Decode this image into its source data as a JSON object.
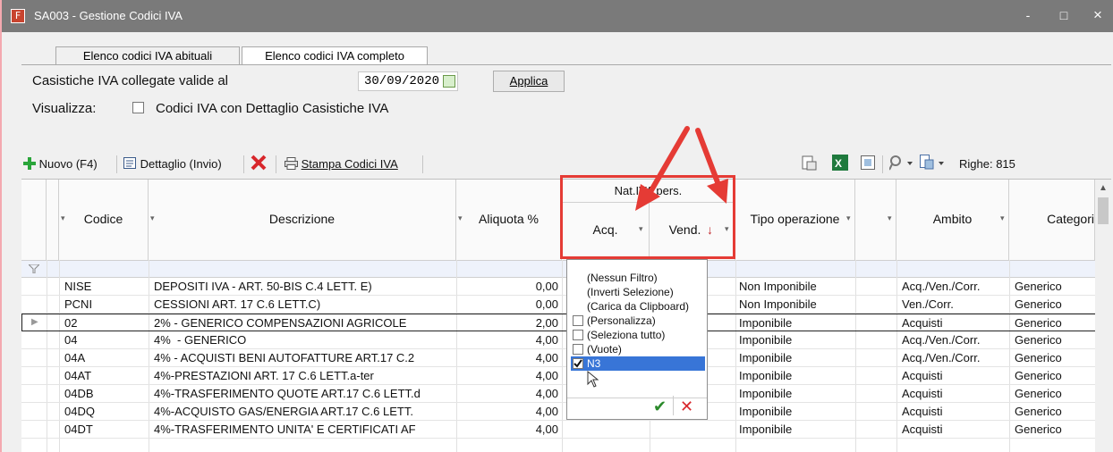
{
  "window": {
    "title": "SA003 - Gestione Codici IVA",
    "app_icon": "F",
    "minimize_label": "-",
    "maximize_label": "□",
    "close_label": "×"
  },
  "tabs": [
    {
      "label": "Elenco codici IVA abituali",
      "active": false
    },
    {
      "label": "Elenco codici IVA completo",
      "active": true
    }
  ],
  "filters": {
    "casistiche_label": "Casistiche IVA collegate valide al",
    "date_value": "30/09/2020",
    "apply_label": "Applica",
    "visualizza_label": "Visualizza:",
    "dettaglio_label": "Codici IVA con Dettaglio Casistiche IVA"
  },
  "toolbar": {
    "new_label": "Nuovo (F4)",
    "detail_label": "Dettaglio (Invio)",
    "print_label": "Stampa Codici IVA",
    "rows_label": "Righe: 815"
  },
  "grid": {
    "group_header": "Nat.IVA pers.",
    "headers": {
      "codice": "Codice",
      "descrizione": "Descrizione",
      "aliquota": "Aliquota %",
      "acq": "Acq.",
      "vend": "Vend.",
      "tipo": "Tipo operazione",
      "ambito": "Ambito",
      "categoria": "Categori"
    },
    "rows": [
      {
        "codice": "NISE",
        "descrizione": "DEPOSITI IVA - ART. 50-BIS C.4 LETT. E)",
        "aliquota": "0,00",
        "tipo": "Non Imponibile",
        "ambito": "Acq./Ven./Corr.",
        "categoria": "Generico"
      },
      {
        "codice": "PCNI",
        "descrizione": "CESSIONI ART. 17 C.6 LETT.C)",
        "aliquota": "0,00",
        "tipo": "Non Imponibile",
        "ambito": "Ven./Corr.",
        "categoria": "Generico"
      },
      {
        "codice": "02",
        "descrizione": "2% - GENERICO COMPENSAZIONI AGRICOLE",
        "aliquota": "2,00",
        "tipo": "Imponibile",
        "ambito": "Acquisti",
        "categoria": "Generico"
      },
      {
        "codice": "04",
        "descrizione": "4%  - GENERICO",
        "aliquota": "4,00",
        "tipo": "Imponibile",
        "ambito": "Acq./Ven./Corr.",
        "categoria": "Generico"
      },
      {
        "codice": "04A",
        "descrizione": "4% - ACQUISTI BENI AUTOFATTURE ART.17 C.2",
        "aliquota": "4,00",
        "tipo": "Imponibile",
        "ambito": "Acq./Ven./Corr.",
        "categoria": "Generico"
      },
      {
        "codice": "04AT",
        "descrizione": "4%-PRESTAZIONI ART. 17 C.6 LETT.a-ter",
        "aliquota": "4,00",
        "tipo": "Imponibile",
        "ambito": "Acquisti",
        "categoria": "Generico"
      },
      {
        "codice": "04DB",
        "descrizione": "4%-TRASFERIMENTO QUOTE ART.17 C.6 LETT.d",
        "aliquota": "4,00",
        "tipo": "Imponibile",
        "ambito": "Acquisti",
        "categoria": "Generico"
      },
      {
        "codice": "04DQ",
        "descrizione": "4%-ACQUISTO GAS/ENERGIA ART.17 C.6 LETT.",
        "aliquota": "4,00",
        "tipo": "Imponibile",
        "ambito": "Acquisti",
        "categoria": "Generico"
      },
      {
        "codice": "04DT",
        "descrizione": "4%-TRASFERIMENTO UNITA' E CERTIFICATI AF",
        "aliquota": "4,00",
        "tipo": "Imponibile",
        "ambito": "Acquisti",
        "categoria": "Generico"
      }
    ]
  },
  "filter_popup": {
    "items": [
      {
        "label": "(Nessun Filtro)",
        "checkbox": false,
        "checked": false
      },
      {
        "label": "(Inverti Selezione)",
        "checkbox": false,
        "checked": false
      },
      {
        "label": "(Carica da Clipboard)",
        "checkbox": false,
        "checked": false
      },
      {
        "label": "(Personalizza)",
        "checkbox": true,
        "checked": false
      },
      {
        "label": "(Seleziona tutto)",
        "checkbox": true,
        "checked": false
      },
      {
        "label": "(Vuote)",
        "checkbox": true,
        "checked": false
      },
      {
        "label": "N3",
        "checkbox": true,
        "checked": true
      }
    ],
    "ok_glyph": "✔",
    "cancel_glyph": "✕"
  },
  "colors": {
    "titlebar": "#7a7a7a",
    "outer_background": "#f4a9b0",
    "selection": "#3875d7",
    "annotation_red": "#e53b35",
    "add_green": "#2aa53a",
    "delete_red": "#d8262b"
  },
  "icons": [
    "app-icon",
    "add-icon",
    "detail-icon",
    "delete-icon",
    "print-icon",
    "calendar-icon",
    "export-icon",
    "excel-icon",
    "layout-icon",
    "search-icon",
    "column-filter-icon",
    "sort-desc-icon",
    "filter-icon",
    "checkmark-icon",
    "cancel-icon",
    "cursor-icon"
  ]
}
